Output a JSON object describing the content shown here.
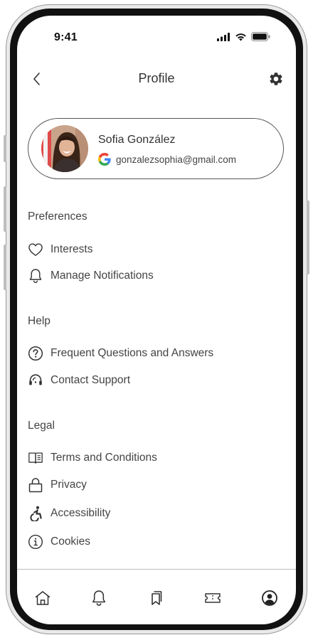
{
  "status_bar": {
    "time": "9:41"
  },
  "header": {
    "title": "Profile"
  },
  "profile": {
    "name": "Sofia González",
    "email": "gonzalezsophia@gmail.com"
  },
  "sections": {
    "preferences": {
      "title": "Preferences",
      "items": [
        {
          "label": "Interests",
          "icon": "heart-icon"
        },
        {
          "label": "Manage Notifications",
          "icon": "bell-icon"
        }
      ]
    },
    "help": {
      "title": "Help",
      "items": [
        {
          "label": "Frequent Questions and Answers",
          "icon": "question-circle-icon"
        },
        {
          "label": "Contact Support",
          "icon": "headset-icon"
        }
      ]
    },
    "legal": {
      "title": "Legal",
      "items": [
        {
          "label": "Terms and Conditions",
          "icon": "book-open-icon"
        },
        {
          "label": "Privacy",
          "icon": "lock-icon"
        },
        {
          "label": "Accessibility",
          "icon": "accessibility-icon"
        },
        {
          "label": "Cookies",
          "icon": "info-circle-icon"
        }
      ]
    }
  },
  "tab_bar": {
    "items": [
      "home-icon",
      "bell-icon",
      "bookmarks-icon",
      "ticket-icon",
      "user-circle-icon"
    ]
  },
  "colors": {
    "text_primary": "#333333",
    "icon": "#333333",
    "divider": "#bdbdbd",
    "google_blue": "#4285F4",
    "google_red": "#EA4335",
    "google_yellow": "#FBBC05",
    "google_green": "#34A853"
  }
}
